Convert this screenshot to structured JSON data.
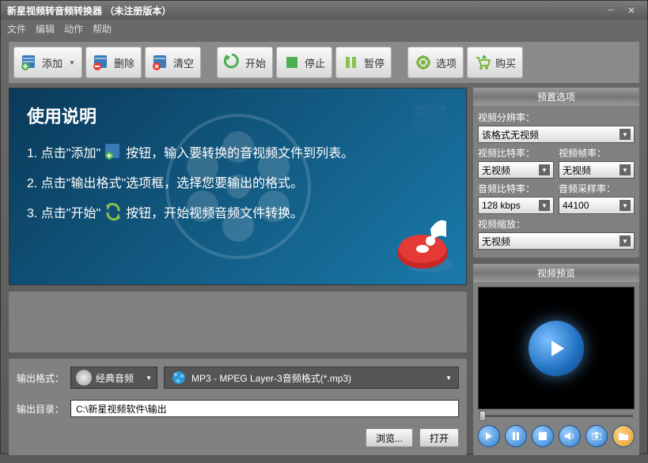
{
  "title": "新星视频转音频转换器  （未注册版本）",
  "menu": [
    "文件",
    "编辑",
    "动作",
    "帮助"
  ],
  "toolbar": {
    "add": "添加",
    "remove": "删除",
    "clear": "清空",
    "start": "开始",
    "stop": "停止",
    "pause": "暂停",
    "options": "选项",
    "buy": "购买"
  },
  "banner": {
    "heading": "使用说明",
    "step1a": "1. 点击\"添加\"",
    "step1b": "按钮，输入要转换的音视频文件到列表。",
    "step2": "2. 点击\"输出格式\"选项框，选择您要输出的格式。",
    "step3a": "3. 点击\"开始\"",
    "step3b": "按钮，开始视频音频文件转换。"
  },
  "output": {
    "format_label": "输出格式：",
    "format_category": "经典音频",
    "format_selected": "MP3 - MPEG Layer-3音频格式(*.mp3)",
    "dir_label": "输出目录：",
    "dir_value": "C:\\新星视频软件\\输出",
    "browse": "浏览...",
    "open": "打开"
  },
  "preset": {
    "title": "预置选项",
    "video_res_lbl": "视频分辨率：",
    "video_res": "该格式无视频",
    "vbitrate_lbl": "视频比特率：",
    "vbitrate": "无视频",
    "vfps_lbl": "视频帧率：",
    "vfps": "无视频",
    "abitrate_lbl": "音频比特率：",
    "abitrate": "128 kbps",
    "asample_lbl": "音频采样率：",
    "asample": "44100",
    "vscale_lbl": "视频缩放：",
    "vscale": "无视频"
  },
  "preview": {
    "title": "视频预览"
  }
}
